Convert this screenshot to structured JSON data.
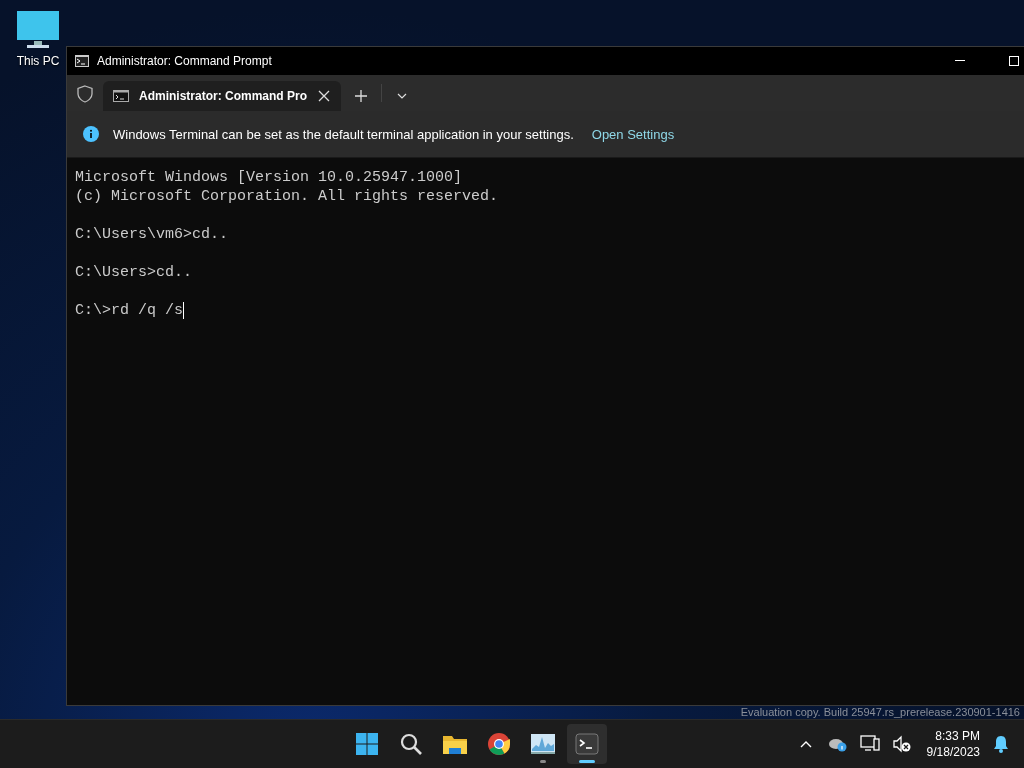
{
  "desktop": {
    "icons": [
      {
        "label": "This PC"
      }
    ]
  },
  "window": {
    "title": "Administrator: Command Prompt",
    "tabs": [
      {
        "label": "Administrator: Command Pro",
        "selected": true
      }
    ],
    "infobar": {
      "message": "Windows Terminal can be set as the default terminal application in your settings.",
      "link": "Open Settings"
    },
    "terminal": {
      "blocks": [
        [
          "Microsoft Windows [Version 10.0.25947.1000]",
          "(c) Microsoft Corporation. All rights reserved."
        ],
        [
          "C:\\Users\\vm6>cd.."
        ],
        [
          "C:\\Users>cd.."
        ],
        [
          "C:\\>rd /q /s"
        ]
      ],
      "cursor": true
    }
  },
  "watermark": "Evaluation copy. Build 25947.rs_prerelease.230901-1416",
  "taskbar": {
    "apps": [
      {
        "kind": "start",
        "running": false,
        "selected": false
      },
      {
        "kind": "search",
        "running": false,
        "selected": false
      },
      {
        "kind": "folder",
        "running": false,
        "selected": false
      },
      {
        "kind": "browser",
        "running": false,
        "selected": false
      },
      {
        "kind": "monitor",
        "running": true,
        "selected": false
      },
      {
        "kind": "terminal",
        "running": true,
        "selected": true
      }
    ],
    "time": "8:33 PM",
    "date": "9/18/2023"
  }
}
